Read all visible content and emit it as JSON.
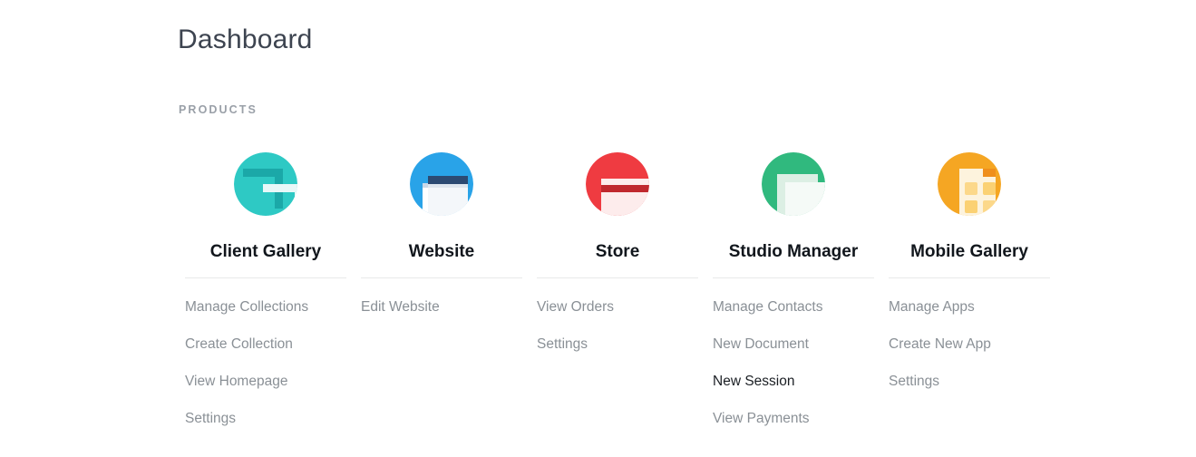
{
  "header": {
    "title": "Dashboard",
    "section_label": "PRODUCTS"
  },
  "colors": {
    "background": "#ffffff",
    "title_text": "#3d4450",
    "section_label_text": "#9aa0a8",
    "product_name_text": "#11161c",
    "link_text": "#8a9096",
    "link_active_text": "#1b1f24",
    "divider": "#e8e9ea",
    "client_gallery_accent": "#2ec9c4",
    "website_accent": "#29a3e8",
    "store_accent": "#ef3b41",
    "studio_manager_accent": "#30b97e",
    "mobile_gallery_accent": "#f5a623"
  },
  "products": [
    {
      "name": "Client Gallery",
      "icon": "client-gallery-icon",
      "links": [
        {
          "label": "Manage Collections",
          "active": false
        },
        {
          "label": "Create Collection",
          "active": false
        },
        {
          "label": "View Homepage",
          "active": false
        },
        {
          "label": "Settings",
          "active": false
        }
      ]
    },
    {
      "name": "Website",
      "icon": "website-icon",
      "links": [
        {
          "label": "Edit Website",
          "active": false
        }
      ]
    },
    {
      "name": "Store",
      "icon": "store-icon",
      "links": [
        {
          "label": "View Orders",
          "active": false
        },
        {
          "label": "Settings",
          "active": false
        }
      ]
    },
    {
      "name": "Studio Manager",
      "icon": "studio-manager-icon",
      "links": [
        {
          "label": "Manage Contacts",
          "active": false
        },
        {
          "label": "New Document",
          "active": false
        },
        {
          "label": "New Session",
          "active": true
        },
        {
          "label": "View Payments",
          "active": false
        }
      ]
    },
    {
      "name": "Mobile Gallery",
      "icon": "mobile-gallery-icon",
      "links": [
        {
          "label": "Manage Apps",
          "active": false
        },
        {
          "label": "Create New App",
          "active": false
        },
        {
          "label": "Settings",
          "active": false
        }
      ]
    }
  ]
}
